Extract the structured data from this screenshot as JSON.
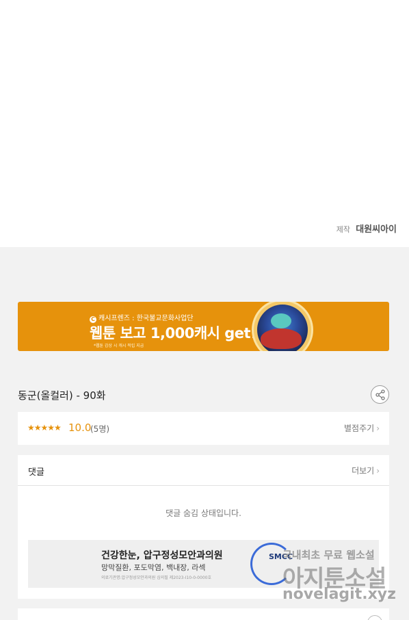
{
  "credit": {
    "label": "제작",
    "name": "대원씨아이"
  },
  "banner": {
    "sponsor": "캐시프렌즈 : 한국불교문화사업단",
    "c_icon": "C",
    "headline": "웹툰 보고 1,000캐시 get!",
    "note": "*웹툰 감상 시 캐시 적립 지급",
    "accent_color": "#e6920c"
  },
  "episode": {
    "title": "동군(올컬러) - 90화",
    "share_icon": "share-icon"
  },
  "rating": {
    "stars": "★★★★★",
    "score": "10.0",
    "count": "(5명)",
    "rate_link": "별점주기"
  },
  "comments": {
    "title": "댓글",
    "more_link": "더보기",
    "hidden_message": "댓글 숨김 상태입니다."
  },
  "ad": {
    "title": "건강한눈, 압구정성모안과의원",
    "subtitle": "망막질환, 포도막염, 백내장, 라섹",
    "fine_print": "의료기관명:압구정성모안과의원 심의필 제2023-I10-0-0000호",
    "logo": "SMCC"
  },
  "watermark": {
    "line1": "국내최초 무료 웹소설",
    "line2": "아지툰소설",
    "line3": "novelagit.xyz"
  },
  "chevron": "›"
}
